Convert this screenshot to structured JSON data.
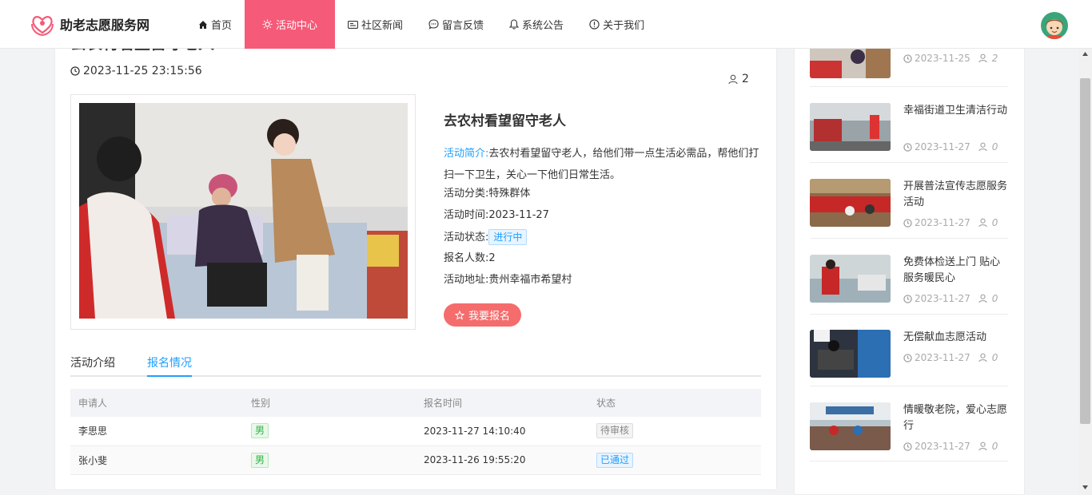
{
  "brand": {
    "name": "助老志愿服务网"
  },
  "nav": {
    "items": [
      {
        "label": "首页",
        "icon": "home-icon"
      },
      {
        "label": "活动中心",
        "icon": "sun-icon",
        "active": true
      },
      {
        "label": "社区新闻",
        "icon": "news-icon"
      },
      {
        "label": "留言反馈",
        "icon": "chat-icon"
      },
      {
        "label": "系统公告",
        "icon": "bell-icon"
      },
      {
        "label": "关于我们",
        "icon": "info-icon"
      }
    ]
  },
  "activity": {
    "title": "去农村看望留守老人",
    "posted_at": "2023-11-25 23:15:56",
    "views": "2",
    "intro_label": "活动简介:",
    "intro": "去农村看望留守老人，给他们带一点生活必需品，帮他们打扫一下卫生，关心一下他们日常生活。",
    "category_label": "活动分类:",
    "category": "特殊群体",
    "time_label": "活动时间:",
    "time": "2023-11-27",
    "status_label": "活动状态:",
    "status": "进行中",
    "count_label": "报名人数:",
    "count": "2",
    "address_label": "活动地址:",
    "address": "贵州幸福市希望村",
    "signup_label": "我要报名"
  },
  "tabs": {
    "intro": "活动介绍",
    "signups": "报名情况"
  },
  "table": {
    "headers": [
      "申请人",
      "性别",
      "报名时间",
      "状态"
    ],
    "rows": [
      {
        "name": "李思思",
        "gender": "男",
        "time": "2023-11-27 14:10:40",
        "status": "待审核"
      },
      {
        "name": "张小斐",
        "gender": "男",
        "time": "2023-11-26 19:55:20",
        "status": "已通过"
      }
    ]
  },
  "sidebar": {
    "items": [
      {
        "title": "",
        "date": "2023-11-25",
        "count": "2"
      },
      {
        "title": "幸福街道卫生清洁行动",
        "date": "2023-11-27",
        "count": "0"
      },
      {
        "title": "开展普法宣传志愿服务活动",
        "date": "2023-11-27",
        "count": "0"
      },
      {
        "title": "免费体检送上门 贴心服务暖民心",
        "date": "2023-11-27",
        "count": "0"
      },
      {
        "title": "无偿献血志愿活动",
        "date": "2023-11-27",
        "count": "0"
      },
      {
        "title": "情暖敬老院，爱心志愿行",
        "date": "2023-11-27",
        "count": "0"
      }
    ]
  },
  "colors": {
    "accent": "#f55a78",
    "link": "#1e9fff",
    "button": "#f56c6c"
  }
}
